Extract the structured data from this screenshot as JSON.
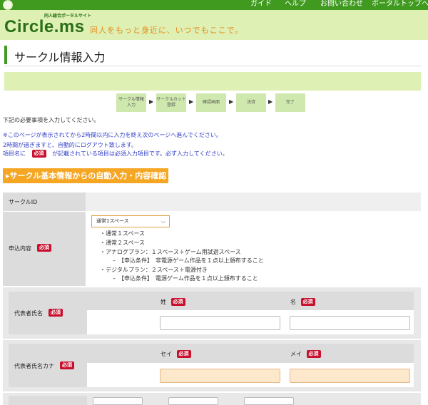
{
  "nav": {
    "links": [
      "ガイド",
      "ヘルプ",
      "お問い合わせ",
      "ポータルトップへ"
    ]
  },
  "header": {
    "brand": "Circle.ms",
    "brand_sub": "同人総合ポータルサイト",
    "tagline": "同人をもっと身近に、いつでもここで。"
  },
  "page": {
    "title": "サークル情報入力"
  },
  "steps": [
    {
      "label": "サークル情報\n入力"
    },
    {
      "label": "サークルカット\n登録"
    },
    {
      "label": "確認画面"
    },
    {
      "label": "決済"
    },
    {
      "label": "完了"
    }
  ],
  "intro": {
    "line1": "下記の必要事項を入力してください。",
    "line2": "※このページが表示されてから2時間以内に入力を終え次のページへ進んでください。",
    "line3": "2時間が過ぎますと、自動的にログアウト致します。",
    "line4_pre": "項目名に",
    "line4_post": "が記載されている項目は必須入力項目です。必ず入力してください。"
  },
  "required_badge": "必須",
  "auto_fill_button": "▸サークル基本情報からの自動入力・内容確認",
  "form": {
    "circle_id_label": "サークルID",
    "application_label": "申込内容",
    "application_select_value": "通常1スペース",
    "plans": [
      "・通常１スペース",
      "・通常２スペース",
      "・アナログプラン：１スペース＋ゲーム用試遊スペース",
      "–　【申込条件】　非電源ゲーム作品を１点以上頒布すること",
      "・デジタルプラン：２スペース＋電源付き",
      "–　【申込条件】　電源ゲーム作品を１点以上頒布すること"
    ],
    "rep_name_label": "代表者氏名",
    "last_name_label": "姓",
    "first_name_label": "名",
    "rep_kana_label": "代表者氏名カナ",
    "last_kana_label": "セイ",
    "first_kana_label": "メイ"
  },
  "colors": {
    "nav_green": "#3f9a1f",
    "header_bg": "#dff0b4",
    "accent_orange": "#f5a623",
    "required_red": "#c8102e",
    "notice_blue": "#3340c8"
  }
}
